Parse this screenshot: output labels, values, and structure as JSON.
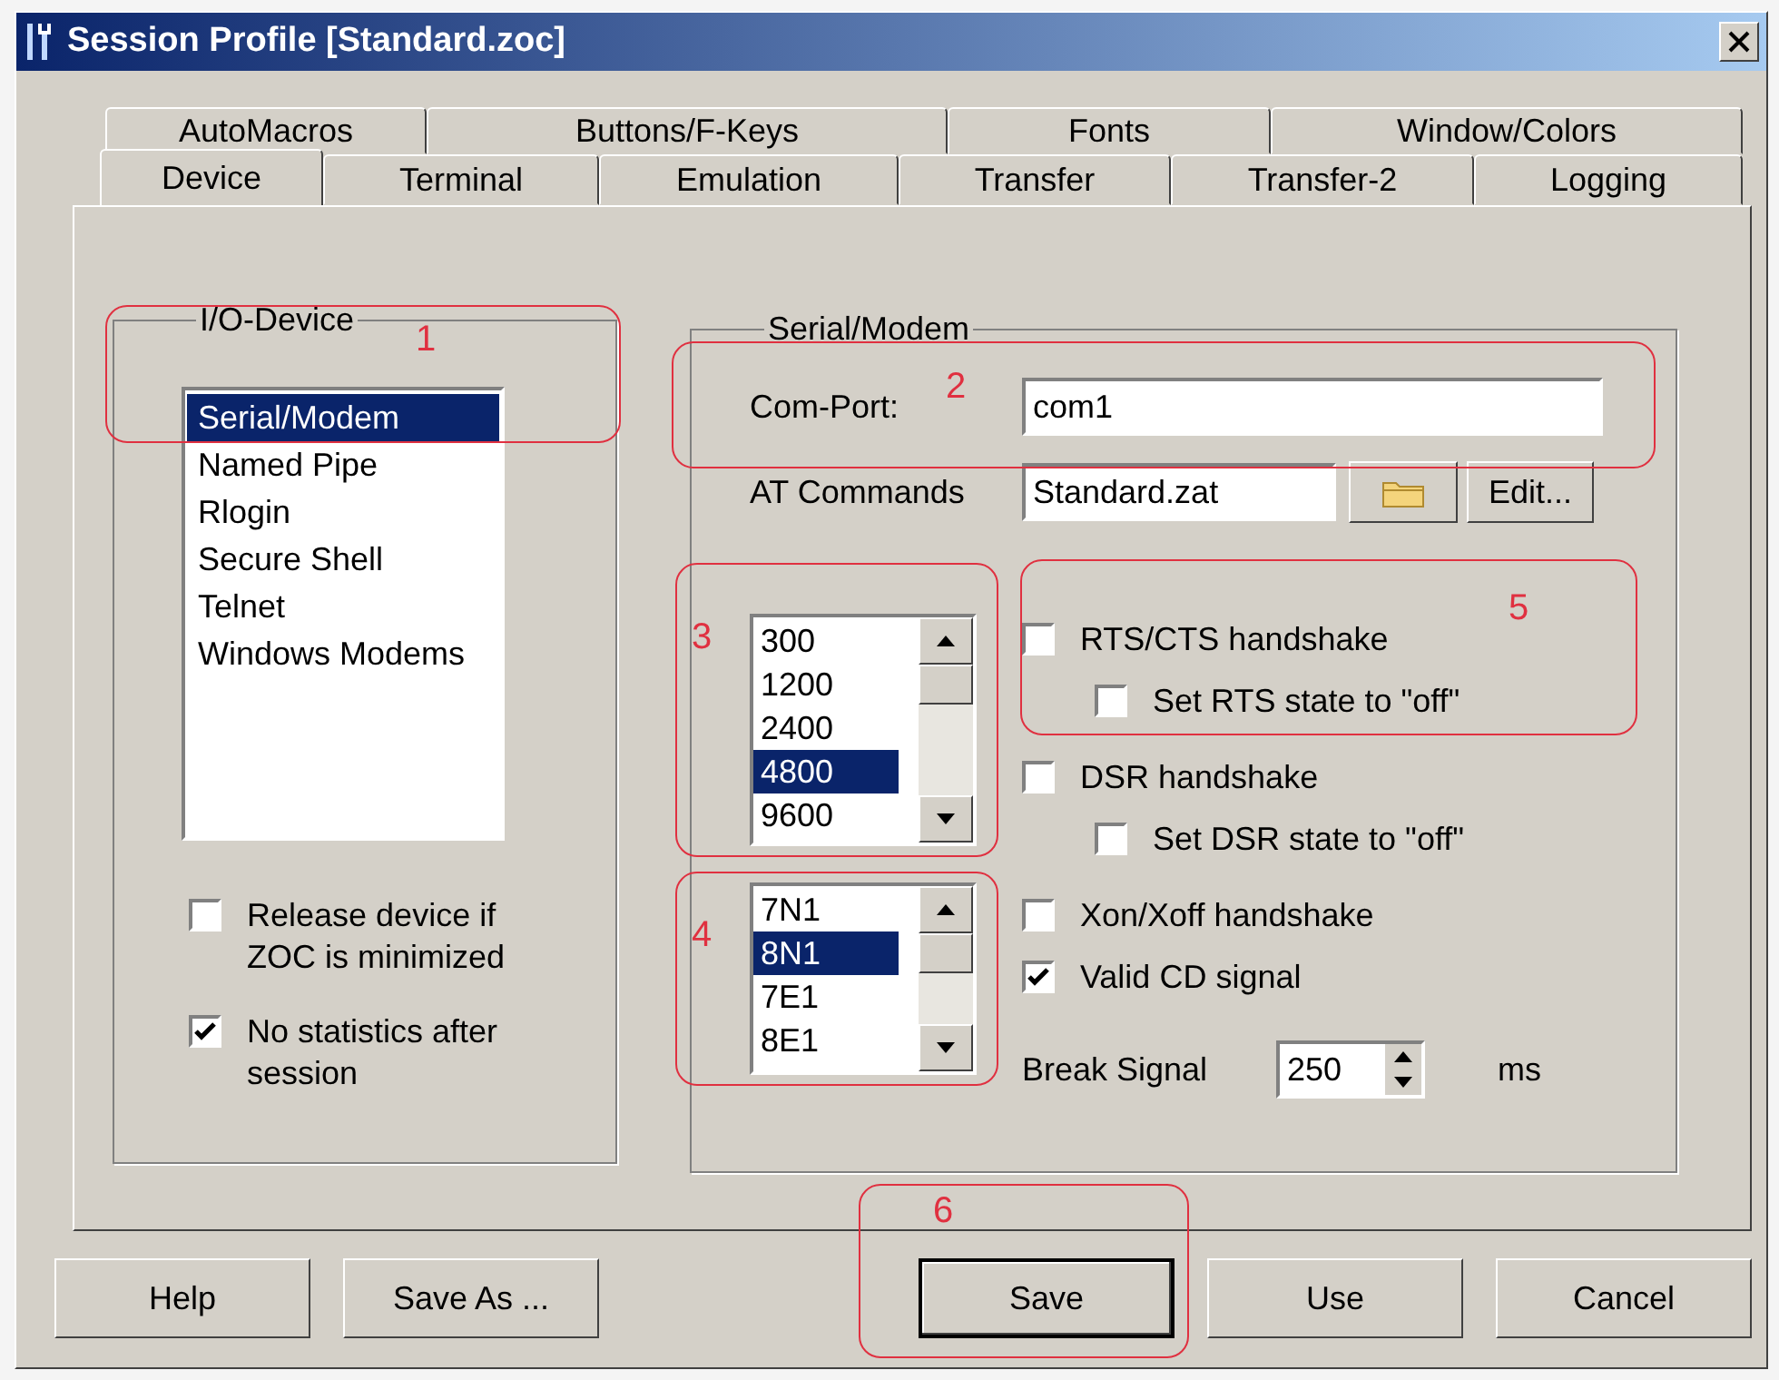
{
  "window": {
    "title": "Session Profile [Standard.zoc]"
  },
  "tabs_back": [
    {
      "label": "AutoMacros",
      "selected": false
    },
    {
      "label": "Buttons/F-Keys",
      "selected": false
    },
    {
      "label": "Fonts",
      "selected": false
    },
    {
      "label": "Window/Colors",
      "selected": false
    }
  ],
  "tabs_front": [
    {
      "label": "Device",
      "selected": true
    },
    {
      "label": "Terminal",
      "selected": false
    },
    {
      "label": "Emulation",
      "selected": false
    },
    {
      "label": "Transfer",
      "selected": false
    },
    {
      "label": "Transfer-2",
      "selected": false
    },
    {
      "label": "Logging",
      "selected": false
    }
  ],
  "io_device": {
    "legend": "I/O-Device",
    "items": [
      {
        "label": "Serial/Modem",
        "selected": true
      },
      {
        "label": "Named Pipe",
        "selected": false
      },
      {
        "label": "Rlogin",
        "selected": false
      },
      {
        "label": "Secure Shell",
        "selected": false
      },
      {
        "label": "Telnet",
        "selected": false
      },
      {
        "label": "Windows Modems",
        "selected": false
      }
    ],
    "options": [
      {
        "label": "Release device if ZOC is minimized",
        "checked": false
      },
      {
        "label": "No statistics after session",
        "checked": true
      }
    ]
  },
  "serial": {
    "legend": "Serial/Modem",
    "com_port": {
      "label": "Com-Port:",
      "value": "com1"
    },
    "at_commands": {
      "label": "AT Commands",
      "value": "Standard.zat",
      "button": "Edit..."
    },
    "speeds": [
      {
        "label": "300",
        "selected": false
      },
      {
        "label": "1200",
        "selected": false
      },
      {
        "label": "2400",
        "selected": false
      },
      {
        "label": "4800",
        "selected": true
      },
      {
        "label": "9600",
        "selected": false
      }
    ],
    "formats": [
      {
        "label": "7N1",
        "selected": false
      },
      {
        "label": "8N1",
        "selected": true
      },
      {
        "label": "7E1",
        "selected": false
      },
      {
        "label": "8E1",
        "selected": false
      }
    ],
    "options": [
      {
        "label": "RTS/CTS handshake",
        "checked": false,
        "children": [
          {
            "label": "Set RTS state to \"off\"",
            "checked": false
          }
        ]
      },
      {
        "label": "DSR handshake",
        "checked": false,
        "children": [
          {
            "label": "Set DSR state to \"off\"",
            "checked": false
          }
        ]
      },
      {
        "label": "Xon/Xoff handshake",
        "checked": false
      },
      {
        "label": "Valid CD signal",
        "checked": true
      }
    ],
    "break_signal": {
      "label": "Break Signal",
      "value": "250",
      "unit": "ms"
    }
  },
  "buttons": [
    {
      "label": "Help",
      "default": false
    },
    {
      "label": "Save As ...",
      "default": false
    },
    {
      "label": "Save",
      "default": true
    },
    {
      "label": "Use",
      "default": false
    },
    {
      "label": "Cancel",
      "default": false
    }
  ],
  "callouts": [
    {
      "label": "1"
    },
    {
      "label": "2"
    },
    {
      "label": "3"
    },
    {
      "label": "4"
    },
    {
      "label": "5"
    },
    {
      "label": "6"
    }
  ]
}
